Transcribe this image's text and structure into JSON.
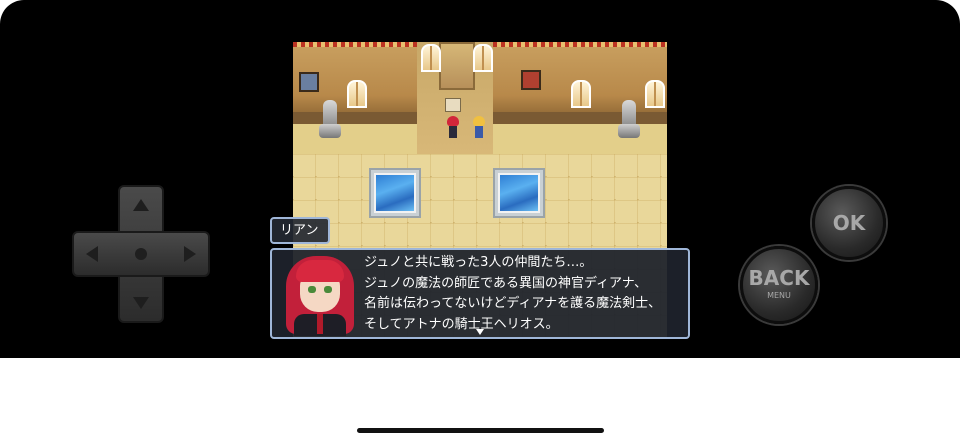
{
  "dialogue": {
    "speaker": "リアン",
    "lines": [
      "ジュノと共に戦った3人の仲間たち…。",
      "ジュノの魔法の師匠である異国の神官ディアナ、",
      "名前は伝わってないけどディアナを護る魔法剣士、",
      "そしてアトナの騎士王ヘリオス。"
    ]
  },
  "controls": {
    "ok_label": "OK",
    "back_label": "BACK",
    "back_sublabel": "MENU"
  },
  "icons": {
    "dpad": "dpad-icon",
    "continue": "continue-arrow-icon"
  }
}
